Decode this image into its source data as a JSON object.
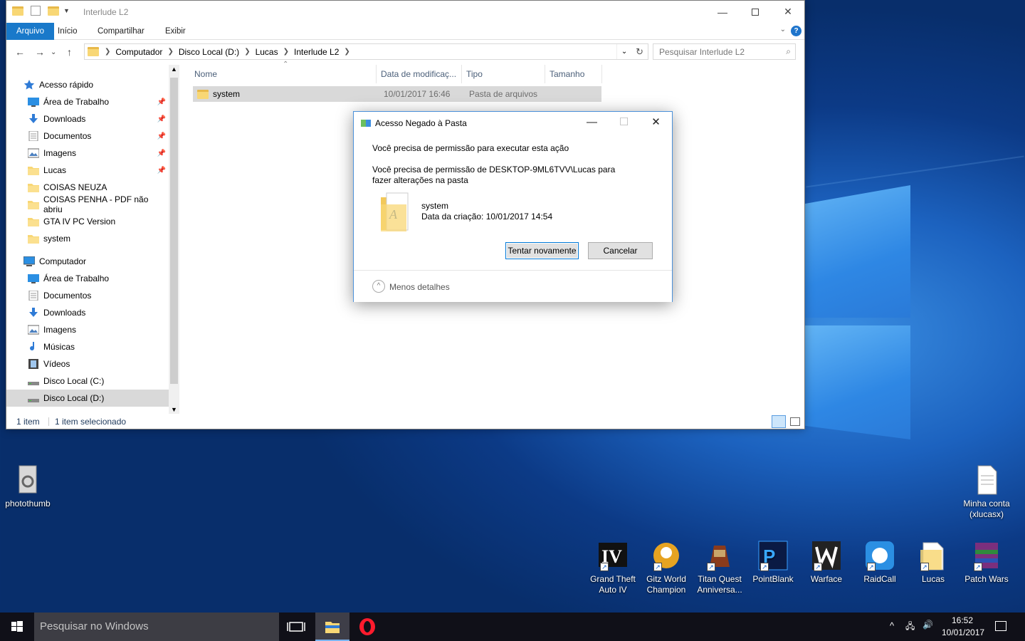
{
  "explorer": {
    "title": "Interlude L2",
    "ribbon_tabs": [
      "Arquivo",
      "Início",
      "Compartilhar",
      "Exibir"
    ],
    "breadcrumb": [
      "Computador",
      "Disco Local (D:)",
      "Lucas",
      "Interlude L2"
    ],
    "search_placeholder": "Pesquisar Interlude L2",
    "nav": {
      "quick_access": "Acesso rápido",
      "quick_items": [
        {
          "label": "Área de Trabalho",
          "pinned": true,
          "icon": "desktop-icon"
        },
        {
          "label": "Downloads",
          "pinned": true,
          "icon": "download-arrow-icon"
        },
        {
          "label": "Documentos",
          "pinned": true,
          "icon": "document-icon"
        },
        {
          "label": "Imagens",
          "pinned": true,
          "icon": "image-icon"
        },
        {
          "label": "Lucas",
          "pinned": true,
          "icon": "folder-icon"
        },
        {
          "label": "COISAS NEUZA",
          "pinned": false,
          "icon": "folder-icon"
        },
        {
          "label": "COISAS PENHA - PDF não abriu",
          "pinned": false,
          "icon": "folder-icon"
        },
        {
          "label": "GTA IV PC Version",
          "pinned": false,
          "icon": "folder-icon"
        },
        {
          "label": "system",
          "pinned": false,
          "icon": "folder-icon"
        }
      ],
      "computer": "Computador",
      "computer_items": [
        {
          "label": "Área de Trabalho",
          "icon": "desktop-icon"
        },
        {
          "label": "Documentos",
          "icon": "document-icon"
        },
        {
          "label": "Downloads",
          "icon": "download-arrow-icon"
        },
        {
          "label": "Imagens",
          "icon": "image-icon"
        },
        {
          "label": "Músicas",
          "icon": "music-note-icon"
        },
        {
          "label": "Vídeos",
          "icon": "video-icon"
        },
        {
          "label": "Disco Local (C:)",
          "icon": "drive-icon"
        },
        {
          "label": "Disco Local (D:)",
          "icon": "drive-icon",
          "selected": true
        }
      ]
    },
    "columns": [
      "Nome",
      "Data de modificaç...",
      "Tipo",
      "Tamanho"
    ],
    "files": [
      {
        "name": "system",
        "modified": "10/01/2017 16:46",
        "type": "Pasta de arquivos",
        "size": ""
      }
    ],
    "status": {
      "count": "1 item",
      "selected": "1 item selecionado"
    }
  },
  "dialog": {
    "title": "Acesso Negado à Pasta",
    "line1": "Você precisa de permissão para executar esta ação",
    "line2": "Você precisa de permissão de DESKTOP-9ML6TVV\\Lucas para fazer alterações na pasta",
    "item_name": "system",
    "item_created": "Data da criação: 10/01/2017 14:54",
    "retry": "Tentar novamente",
    "cancel": "Cancelar",
    "less_details": "Menos detalhes"
  },
  "desktop": {
    "left_icons": [
      {
        "label": "photothumb"
      }
    ],
    "right_icons": [
      {
        "label": "Minha conta (xlucasx)"
      }
    ],
    "shortcuts": [
      {
        "label": "Grand Theft Auto IV"
      },
      {
        "label": "Gitz World Champion"
      },
      {
        "label": "Titan Quest Anniversa..."
      },
      {
        "label": "PointBlank"
      },
      {
        "label": "Warface"
      },
      {
        "label": "RaidCall"
      },
      {
        "label": "Lucas"
      },
      {
        "label": "Patch Wars"
      }
    ]
  },
  "taskbar": {
    "search_placeholder": "Pesquisar no Windows",
    "time": "16:52",
    "date": "10/01/2017"
  },
  "colors": {
    "accent": "#1979ca",
    "taskbar": "#101018",
    "selection": "#d9d9d9"
  }
}
